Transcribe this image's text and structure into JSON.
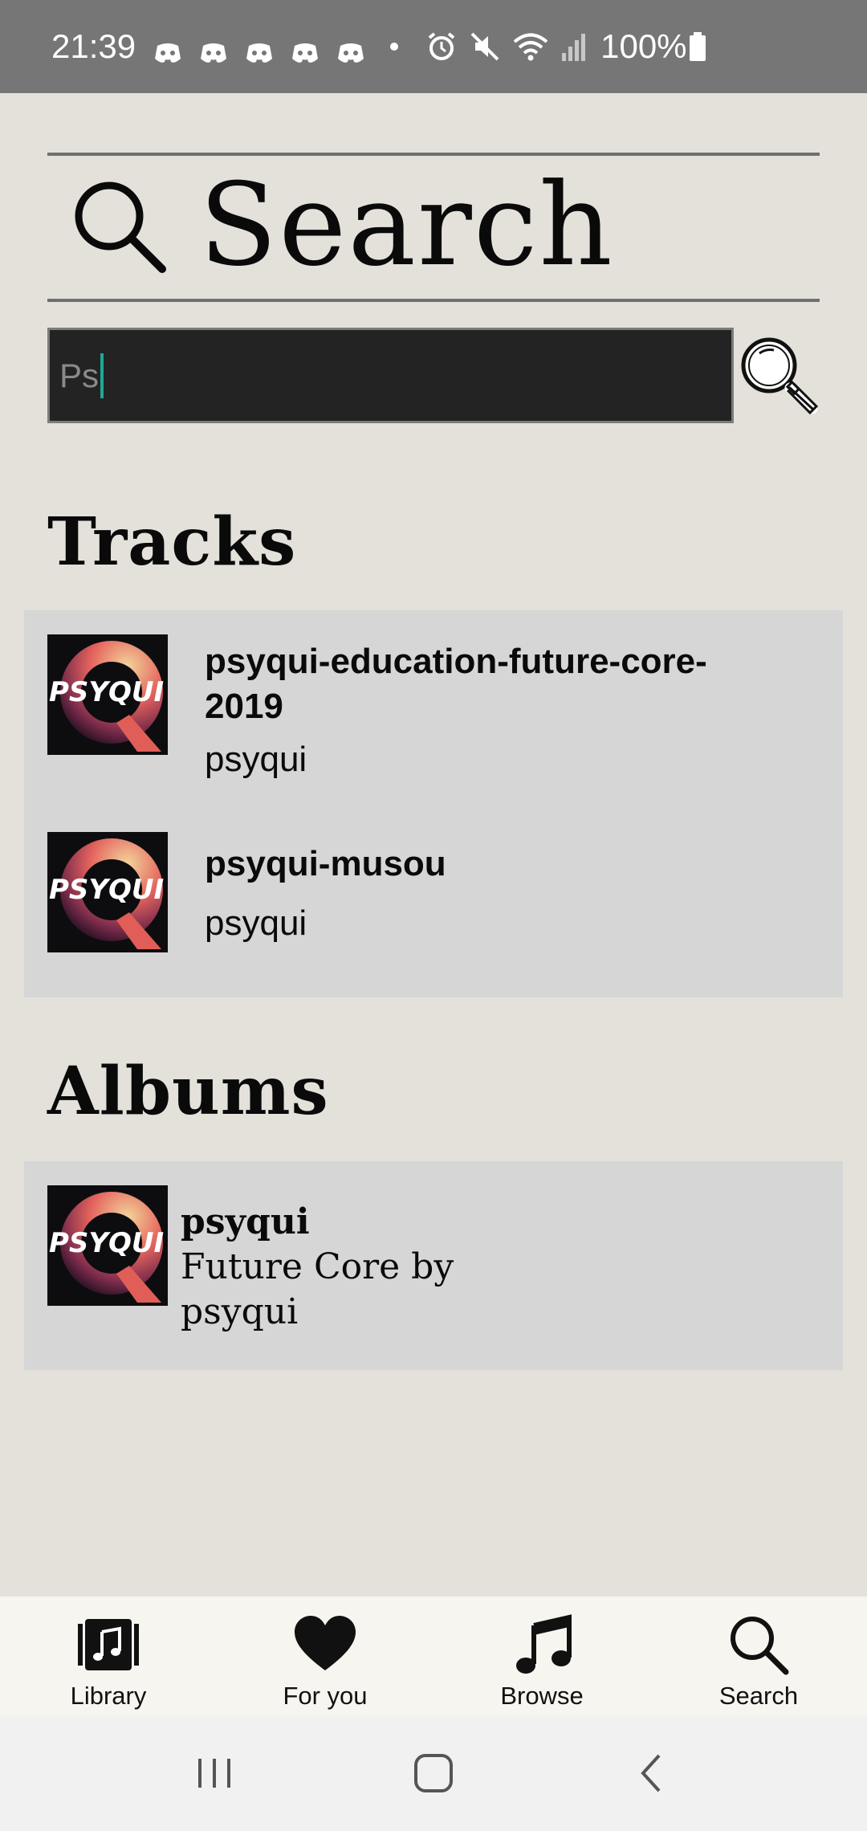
{
  "status_bar": {
    "time": "21:39",
    "battery": "100%",
    "notification_icons": [
      "discord-icon",
      "discord-icon",
      "discord-icon",
      "discord-icon",
      "discord-icon"
    ],
    "system_icons": [
      "alarm-icon",
      "mute-icon",
      "wifi-icon",
      "signal-icon",
      "battery-icon"
    ]
  },
  "header": {
    "title": "Search",
    "icon": "search-icon"
  },
  "search": {
    "value": "Ps",
    "button_icon": "magnifier-icon"
  },
  "tracks": {
    "heading": "Tracks",
    "items": [
      {
        "title": "psyqui-education-future-core-2019",
        "artist": "psyqui",
        "art_text": "PSYQUI"
      },
      {
        "title": "psyqui-musou",
        "artist": "psyqui",
        "art_text": "PSYQUI"
      }
    ]
  },
  "albums": {
    "heading": "Albums",
    "items": [
      {
        "title": "psyqui",
        "subtitle": "Future Core by psyqui",
        "art_text": "PSYQUI"
      }
    ]
  },
  "bottom_nav": {
    "items": [
      {
        "label": "Library",
        "icon": "library-icon"
      },
      {
        "label": "For you",
        "icon": "heart-icon"
      },
      {
        "label": "Browse",
        "icon": "music-note-icon"
      },
      {
        "label": "Search",
        "icon": "search-icon"
      }
    ]
  },
  "system_nav": {
    "items": [
      "recents-icon",
      "home-icon",
      "back-icon"
    ]
  },
  "colors": {
    "background": "#e3e1da",
    "panel": "#d6d6d6",
    "status_bar": "#767676",
    "input_bg": "#232323",
    "caret": "#1ea896"
  }
}
